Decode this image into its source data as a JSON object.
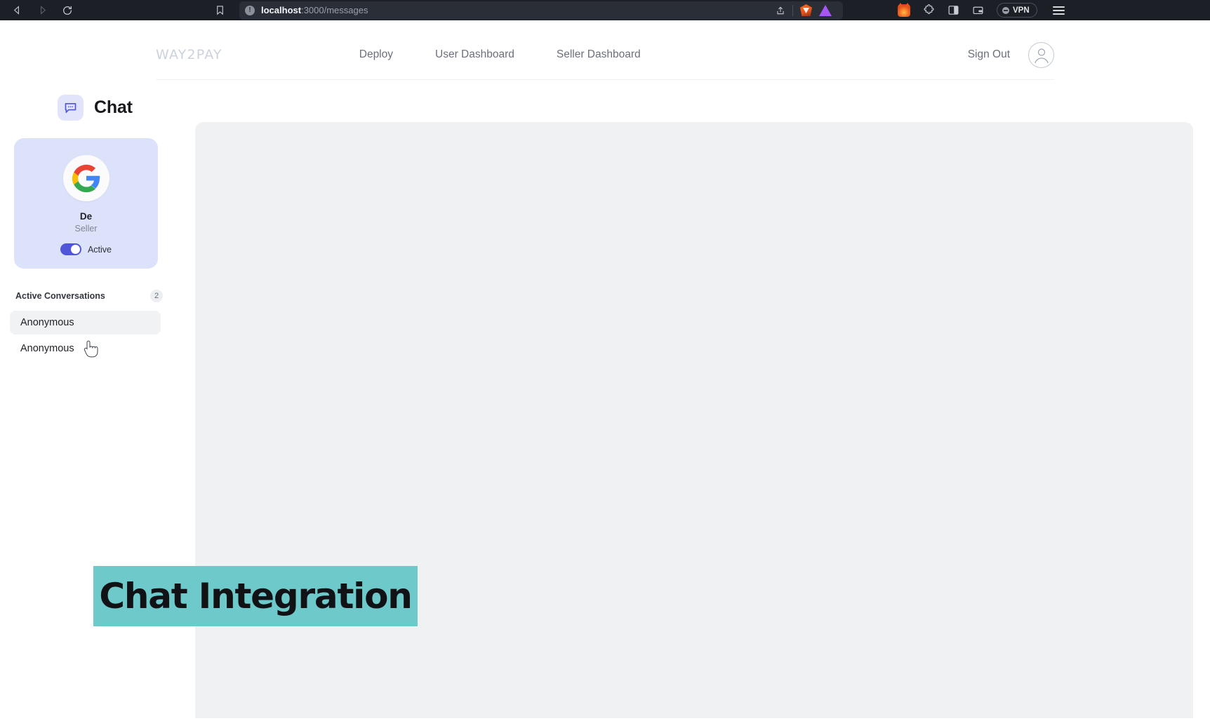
{
  "browser": {
    "back_icon": "back-arrow-icon",
    "forward_icon": "forward-arrow-icon",
    "reload_icon": "reload-icon",
    "bookmark_icon": "bookmark-icon",
    "url_host": "localhost",
    "url_path": ":3000/messages",
    "share_icon": "share-icon",
    "brave_shield_icon": "brave-lion-icon",
    "triangle_icon": "triangle-extension-icon",
    "metamask_icon": "metamask-fox-icon",
    "extensions_icon": "puzzle-piece-icon",
    "sidebar_toggle_icon": "sidebar-panel-icon",
    "wallet_icon": "wallet-icon",
    "vpn_label": "VPN",
    "menu_icon": "hamburger-menu-icon"
  },
  "header": {
    "logo": "WAY2PAY",
    "nav": [
      {
        "label": "Deploy"
      },
      {
        "label": "User Dashboard"
      },
      {
        "label": "Seller Dashboard"
      }
    ],
    "sign_out_label": "Sign Out",
    "avatar_icon": "user-avatar-icon"
  },
  "sidebar": {
    "chat_icon": "chat-bubble-icon",
    "title": "Chat",
    "profile": {
      "avatar_icon": "google-g-icon",
      "name": "De",
      "role": "Seller",
      "status_toggle_on": true,
      "status_label": "Active"
    },
    "conversations": {
      "section_label": "Active Conversations",
      "count": "2",
      "items": [
        {
          "name": "Anonymous",
          "selected": true
        },
        {
          "name": "Anonymous",
          "selected": false
        }
      ]
    }
  },
  "banner": {
    "text": "Chat Integration",
    "background_color": "#6ec9cb",
    "text_color": "#101215"
  },
  "colors": {
    "accent_indigo": "#4f56d8",
    "card_lavender": "#dde2fb",
    "panel_gray": "#f0f1f3",
    "chrome_dark": "#1c1f26"
  }
}
